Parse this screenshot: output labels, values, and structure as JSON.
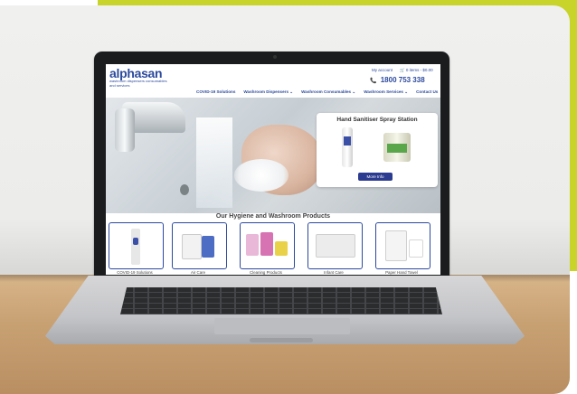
{
  "colors": {
    "accent": "#c8d42a",
    "brand": "#2c4a9e",
    "button": "#2b3b8f"
  },
  "site": {
    "logo": "alphasan",
    "tagline": "washroom dispensers consumables and services",
    "my_account": "My account",
    "cart": "0 items - $0.00",
    "cart_icon": "cart-icon",
    "phone": "1800 753 338",
    "phone_icon": "phone-icon",
    "nav": [
      "COVID-19 Solutions",
      "Washroom Dispensers ⌄",
      "Washroom Consumables ⌄",
      "Washroom Services ⌄",
      "Contact Us"
    ],
    "promo": {
      "title": "Hand Sanitiser Spray Station",
      "button": "More Info"
    },
    "products_title": "Our Hygiene and Washroom Products",
    "products": [
      "COVID-19 Solutions",
      "Air Care",
      "Cleaning Products",
      "Infant Care",
      "Paper Hand Towel"
    ]
  }
}
